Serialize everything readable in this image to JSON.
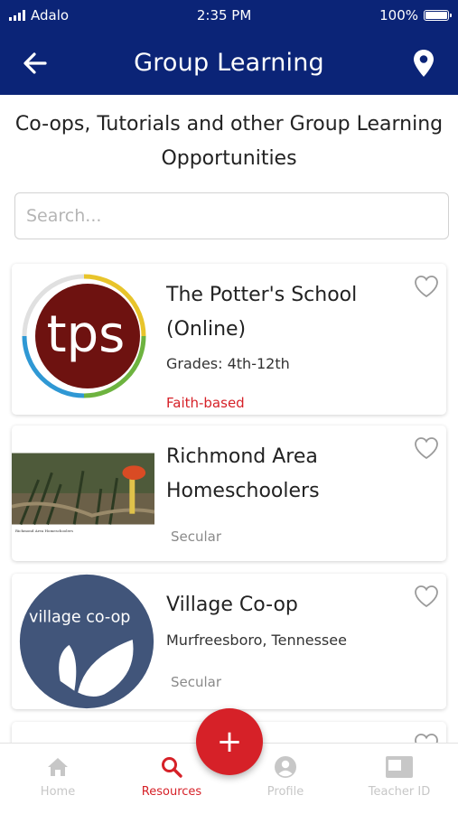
{
  "status_bar": {
    "carrier": "Adalo",
    "time": "2:35 PM",
    "battery": "100%"
  },
  "header": {
    "title": "Group Learning"
  },
  "subtitle": "Co-ops, Tutorials and other Group Learning Opportunities",
  "search": {
    "placeholder": "Search...",
    "value": ""
  },
  "cards": [
    {
      "name": "The Potter's School (Online)",
      "detail": "Grades: 4th-12th",
      "tag": "Faith-based",
      "thumb_text": "tps",
      "favorited": false
    },
    {
      "name": "Richmond Area Homeschoolers",
      "detail": "",
      "tag": "Secular",
      "thumb_caption": "Richmond Area Homeschoolers",
      "favorited": false
    },
    {
      "name": "Village Co-op",
      "detail": "Murfreesboro, Tennessee",
      "tag": "Secular",
      "thumb_text": "village co-op",
      "favorited": false
    }
  ],
  "nav": {
    "items": [
      {
        "label": "Home",
        "icon": "home-icon",
        "active": false
      },
      {
        "label": "Resources",
        "icon": "search-icon",
        "active": true
      },
      {
        "label": "Profile",
        "icon": "person-icon",
        "active": false
      },
      {
        "label": "Teacher ID",
        "icon": "id-card-icon",
        "active": false
      }
    ],
    "fab_label": "+"
  },
  "colors": {
    "brand": "#0b2477",
    "accent": "#d62128",
    "faith_tag": "#d62128",
    "secular_tag": "#8a8a8a"
  }
}
